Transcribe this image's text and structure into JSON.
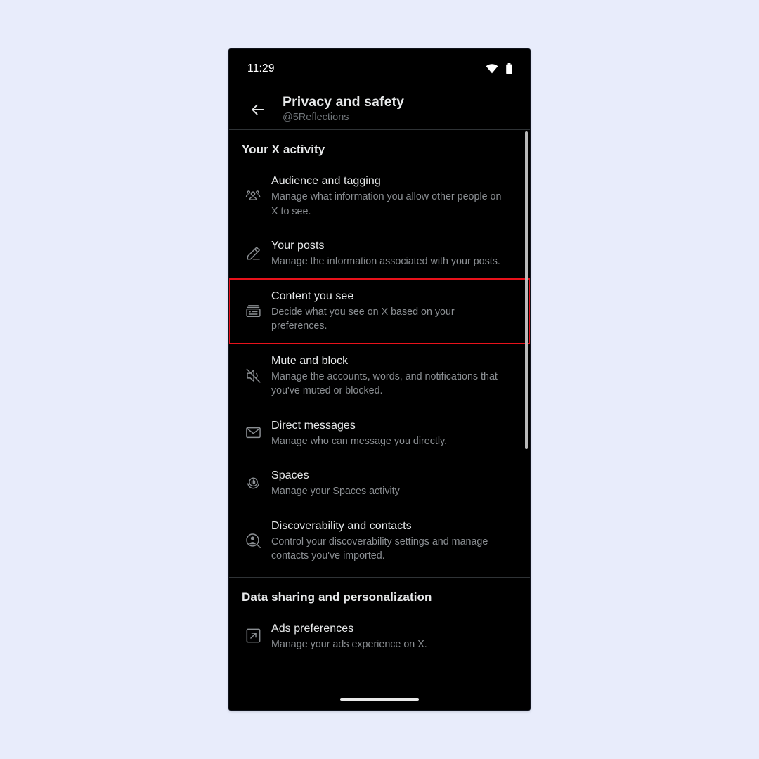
{
  "theme": {
    "page_background": "#e8ecfb",
    "app_background": "#000000",
    "text_primary": "#e7e9ea",
    "text_secondary": "#8b8f93",
    "divider": "#2f3336",
    "highlight_outline": "#e8121b",
    "scrollbar": "#b9b9b9"
  },
  "status_bar": {
    "time": "11:29",
    "icons": [
      "wifi-icon",
      "battery-icon"
    ]
  },
  "header": {
    "back_icon": "back-arrow-icon",
    "title": "Privacy and safety",
    "subtitle": "@5Reflections"
  },
  "sections": [
    {
      "heading": "Your X activity",
      "items": [
        {
          "icon": "audience-people-icon",
          "title": "Audience and tagging",
          "description": "Manage what information you allow other people on X to see.",
          "highlighted": false
        },
        {
          "icon": "pencil-icon",
          "title": "Your posts",
          "description": "Manage the information associated with your posts.",
          "highlighted": false
        },
        {
          "icon": "content-card-icon",
          "title": "Content you see",
          "description": "Decide what you see on X based on your preferences.",
          "highlighted": true
        },
        {
          "icon": "mute-speaker-icon",
          "title": "Mute and block",
          "description": "Manage the accounts, words, and notifications that you've muted or blocked.",
          "highlighted": false
        },
        {
          "icon": "envelope-icon",
          "title": "Direct messages",
          "description": "Manage who can message you directly.",
          "highlighted": false
        },
        {
          "icon": "spaces-microphone-icon",
          "title": "Spaces",
          "description": "Manage your Spaces activity",
          "highlighted": false
        },
        {
          "icon": "person-search-icon",
          "title": "Discoverability and contacts",
          "description": "Control your discoverability settings and manage contacts you've imported.",
          "highlighted": false
        }
      ]
    },
    {
      "heading": "Data sharing and personalization",
      "items": [
        {
          "icon": "external-link-icon",
          "title": "Ads preferences",
          "description": "Manage your ads experience on X.",
          "highlighted": false
        }
      ]
    }
  ],
  "navigation": {
    "home_indicator": "home-indicator-bar"
  }
}
